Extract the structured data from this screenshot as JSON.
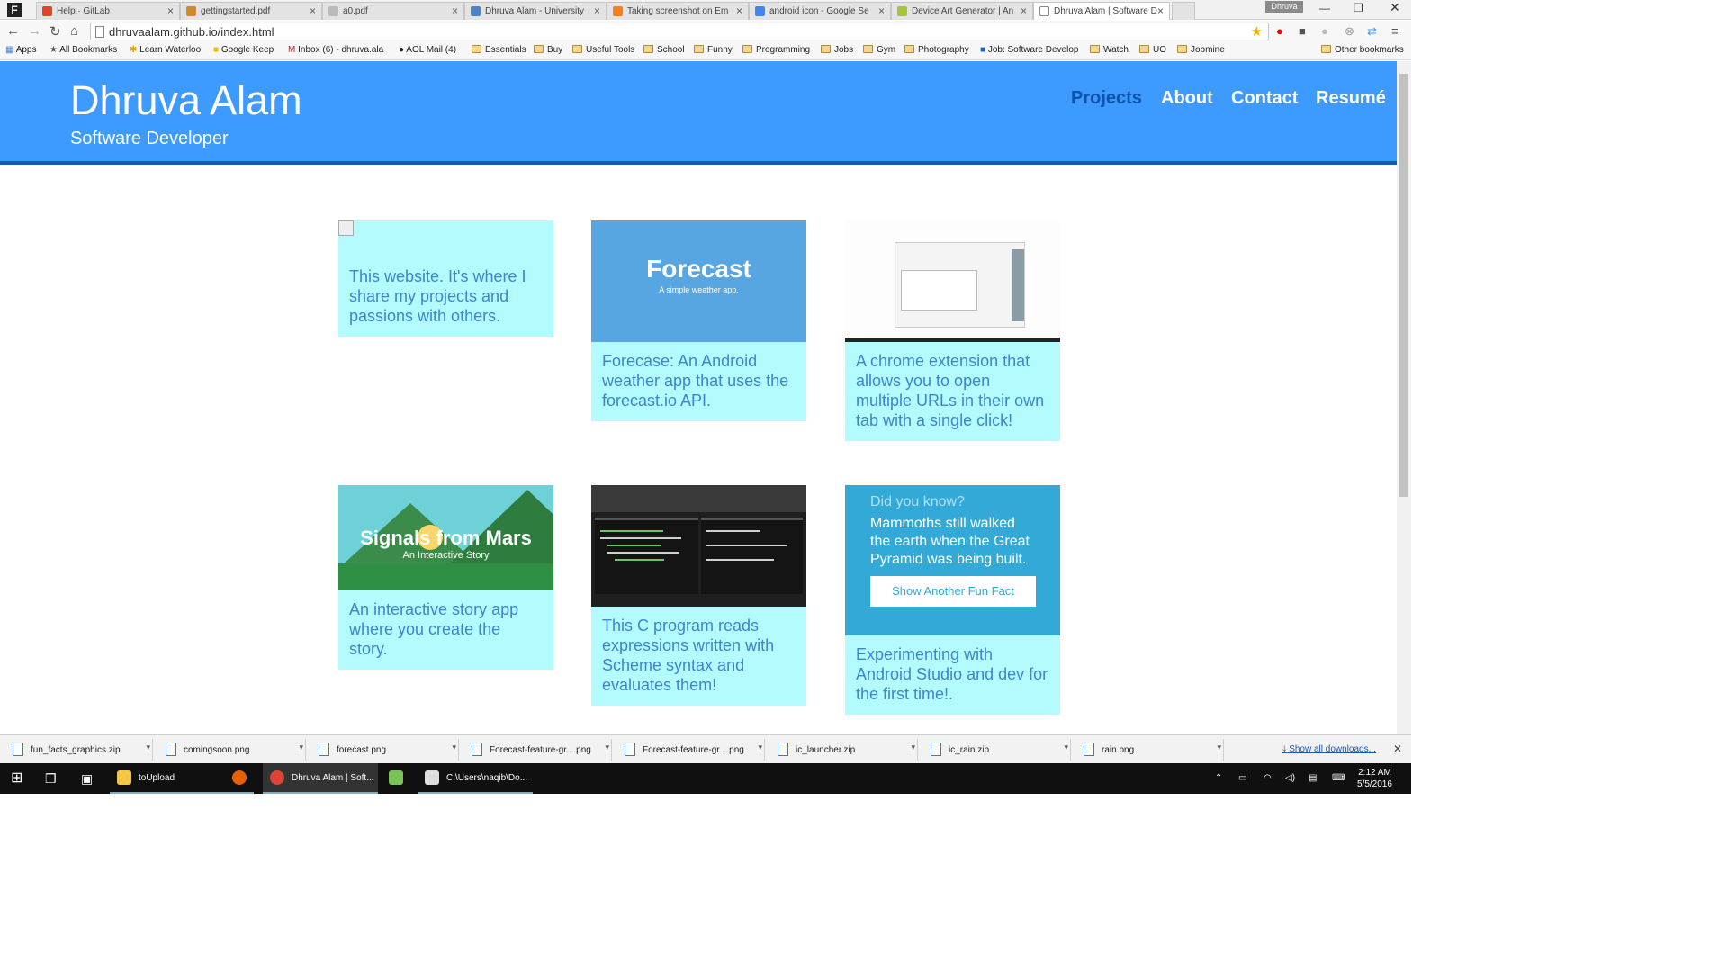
{
  "browser": {
    "tabs": [
      {
        "label": "Help · GitLab",
        "icon_color": "#e24329"
      },
      {
        "label": "gettingstarted.pdf",
        "icon_color": "#d0892b"
      },
      {
        "label": "a0.pdf",
        "icon_color": "#777777"
      },
      {
        "label": "Dhruva Alam - University",
        "icon_color": "#4a84c4"
      },
      {
        "label": "Taking screenshot on Em",
        "icon_color": "#f48024"
      },
      {
        "label": "android icon - Google Se",
        "icon_color": "#4285f4"
      },
      {
        "label": "Device Art Generator | An",
        "icon_color": "#a4c639"
      },
      {
        "label": "Dhruva Alam | Software D",
        "icon_color": "#ffffff"
      }
    ],
    "user_badge": "Dhruva",
    "url": "dhruvaalam.github.io/index.html",
    "bookmarks": [
      {
        "label": "Apps",
        "type": "apps"
      },
      {
        "label": "All Bookmarks",
        "type": "star"
      },
      {
        "label": "Learn Waterloo",
        "type": "site"
      },
      {
        "label": "Google Keep",
        "type": "site"
      },
      {
        "label": "Inbox (6) - dhruva.ala",
        "type": "gmail"
      },
      {
        "label": "AOL Mail (4)",
        "type": "site"
      },
      {
        "label": "Essentials",
        "type": "folder"
      },
      {
        "label": "Buy",
        "type": "folder"
      },
      {
        "label": "Useful Tools",
        "type": "folder"
      },
      {
        "label": "School",
        "type": "folder"
      },
      {
        "label": "Funny",
        "type": "folder"
      },
      {
        "label": "Programming",
        "type": "folder"
      },
      {
        "label": "Jobs",
        "type": "folder"
      },
      {
        "label": "Gym",
        "type": "folder"
      },
      {
        "label": "Photography",
        "type": "folder"
      },
      {
        "label": "Job: Software Develop",
        "type": "site"
      },
      {
        "label": "Watch",
        "type": "folder"
      },
      {
        "label": "UO",
        "type": "folder"
      },
      {
        "label": "Jobmine",
        "type": "folder"
      }
    ],
    "other_bookmarks": "Other bookmarks"
  },
  "site": {
    "name": "Dhruva Alam",
    "tagline": "Software Developer",
    "nav": [
      "Projects",
      "About",
      "Contact",
      "Resumé"
    ],
    "accent": "#3d9bff",
    "nav_active": "#0c53a9"
  },
  "projects": [
    {
      "desc": "This website. It's where I share my projects and passions with others."
    },
    {
      "image_title": "Forecast",
      "image_subtitle": "A simple weather app.",
      "desc": "Forecase: An Android weather app that uses the forecast.io API."
    },
    {
      "desc": "A chrome extension that allows you to open multiple URLs in their own tab with a single click!"
    },
    {
      "image_title": "Signals from Mars",
      "image_subtitle": "An Interactive Story",
      "desc": "An interactive story app where you create the story."
    },
    {
      "desc": "This C program reads expressions written with Scheme syntax and evaluates them!"
    },
    {
      "desc": "Experimenting with Android Studio and dev for the first time!."
    }
  ],
  "fun_fact": {
    "heading": "Did you know?",
    "fact": "Mammoths still walked the earth when the Great Pyramid was being built.",
    "button": "Show Another Fun Fact"
  },
  "downloads": {
    "items": [
      "fun_facts_graphics.zip",
      "comingsoon.png",
      "forecast.png",
      "Forecast-feature-gr....png",
      "Forecast-feature-gr....png",
      "ic_launcher.zip",
      "ic_rain.zip",
      "rain.png"
    ],
    "show_all": "Show all downloads..."
  },
  "taskbar": {
    "items": [
      "toUpload",
      "Dhruva Alam | Soft...",
      "C:\\Users\\naqib\\Do..."
    ],
    "time": "2:12 AM",
    "date": "5/5/2016"
  }
}
